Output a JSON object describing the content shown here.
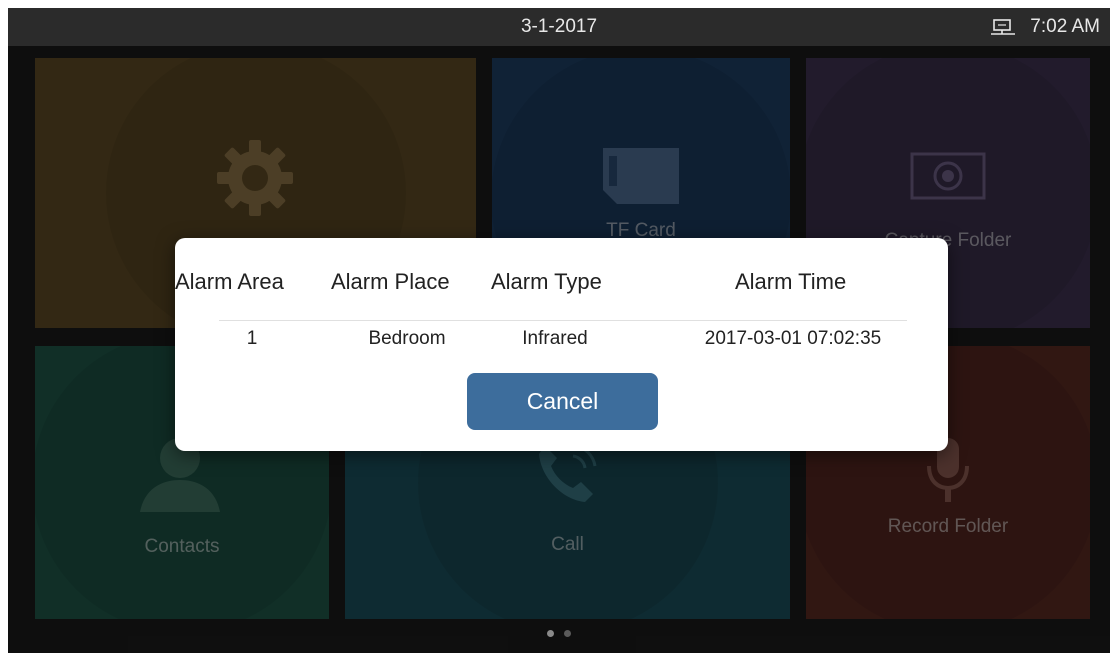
{
  "status_bar": {
    "date": "3-1-2017",
    "time": "7:02 AM",
    "network_icon": "network-icon"
  },
  "home_tiles": [
    {
      "name": "settings",
      "label": "",
      "icon": "gear-icon",
      "color": "#5e4a25"
    },
    {
      "name": "tf-card",
      "label": "TF Card",
      "icon": "sd-card-icon",
      "color": "#1e3e63"
    },
    {
      "name": "capture-folder",
      "label": "Capture Folder",
      "icon": "camera-icon",
      "color": "#3e3251"
    },
    {
      "name": "contacts",
      "label": "Contacts",
      "icon": "person-icon",
      "color": "#1f5648"
    },
    {
      "name": "call",
      "label": "Call",
      "icon": "phone-icon",
      "color": "#1b4f5b"
    },
    {
      "name": "record-folder",
      "label": "Record Folder",
      "icon": "microphone-icon",
      "color": "#5a2a22"
    }
  ],
  "pages": {
    "count": 2,
    "active": 1
  },
  "alarm_dialog": {
    "headers": {
      "area": "Alarm Area",
      "place": "Alarm Place",
      "type": "Alarm Type",
      "time": "Alarm Time"
    },
    "rows": [
      {
        "area": "1",
        "place": "Bedroom",
        "type": "Infrared",
        "time": "2017-03-01 07:02:35"
      }
    ],
    "cancel_label": "Cancel",
    "accent": "#3d6d9c"
  }
}
